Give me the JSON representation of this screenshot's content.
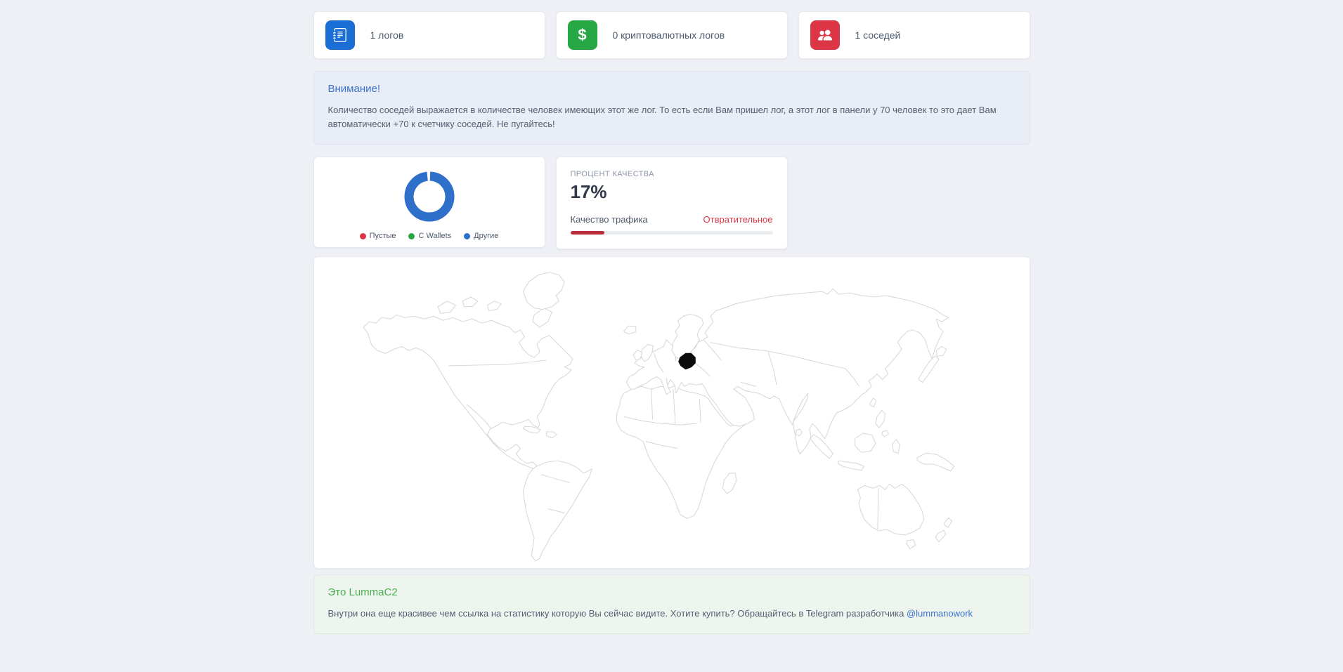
{
  "page": {
    "background": "#eef0f5"
  },
  "stat_cards": [
    {
      "label": "1 логов",
      "icon": "journal-icon",
      "icon_bg": "#1b6ed3"
    },
    {
      "label": "0 криптовалютных логов",
      "icon": "dollar-icon",
      "icon_bg": "#28a745"
    },
    {
      "label": "1 соседей",
      "icon": "people-icon",
      "icon_bg": "#dc3545"
    }
  ],
  "alert": {
    "title": "Внимание!",
    "title_color": "#3b71ca",
    "body": "Количество соседей выражается в количестве человек имеющих этот же лог. То есть если Вам пришел лог, а этот лог в панели у 70 человек то это дает Вам автоматически +70 к счетчику соседей. Не пугайтесь!"
  },
  "chart_data": [
    {
      "type": "pie",
      "donut": true,
      "labels": [
        "Пустые",
        "С Wallets",
        "Другие"
      ],
      "values": [
        0,
        0,
        1
      ],
      "colors": [
        "#dc3545",
        "#28a745",
        "#2e70c9"
      ],
      "legend_position": "bottom",
      "title": ""
    },
    {
      "type": "bar",
      "title": "ПРОЦЕНТ КАЧЕСТВА",
      "categories": [
        "Качество трафика"
      ],
      "values": [
        17
      ],
      "max": 100,
      "bar_color": "#bb2d3b",
      "track_color": "#e9ecef",
      "status": "Отвратительное",
      "status_color": "#dc3545"
    }
  ],
  "quality": {
    "heading": "ПРОЦЕНТ КАЧЕСТВА",
    "percent": "17%",
    "value": 17,
    "label": "Качество трафика",
    "status": "Отвратительное"
  },
  "map": {
    "highlighted_country": "Poland",
    "highlight_color": "#0b0b0b",
    "border_color": "#d2d5da"
  },
  "footer": {
    "title": "Это LummaC2",
    "title_color": "#4bae50",
    "body": "Внутри она еще красивее чем ссылка на статистику которую Вы сейчас видите. Хотите купить? Обращайтесь в Telegram разработчика ",
    "link": "@lummanowork",
    "link_color": "#3b71ca"
  }
}
